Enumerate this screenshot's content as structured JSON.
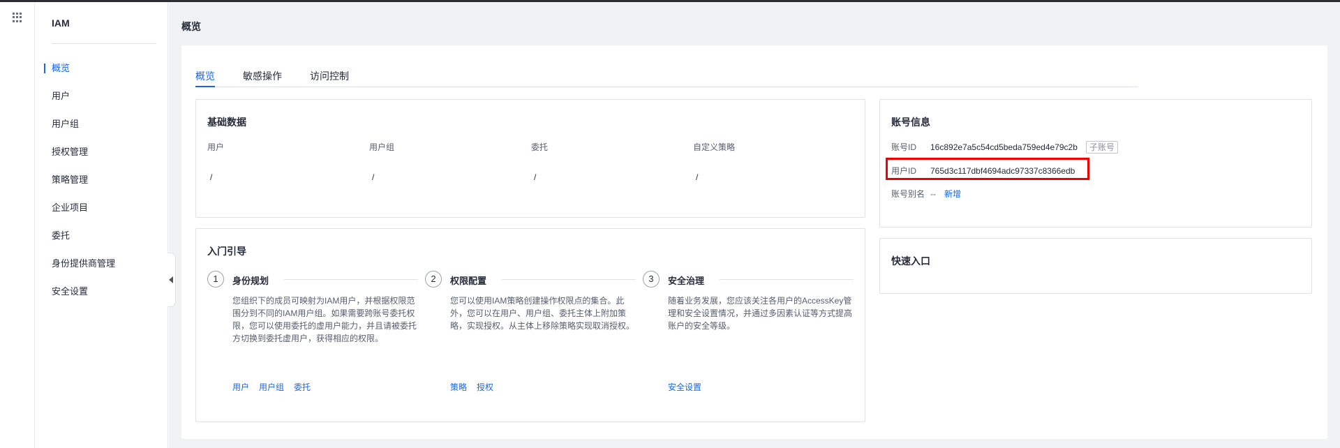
{
  "app": {
    "title": "IAM"
  },
  "sidebar": {
    "items": [
      {
        "label": "概览",
        "active": true
      },
      {
        "label": "用户"
      },
      {
        "label": "用户组"
      },
      {
        "label": "授权管理"
      },
      {
        "label": "策略管理"
      },
      {
        "label": "企业项目"
      },
      {
        "label": "委托"
      },
      {
        "label": "身份提供商管理"
      },
      {
        "label": "安全设置"
      }
    ]
  },
  "page": {
    "title": "概览"
  },
  "tabs": [
    {
      "label": "概览",
      "active": true
    },
    {
      "label": "敏感操作"
    },
    {
      "label": "访问控制"
    }
  ],
  "basic_data": {
    "title": "基础数据",
    "stats": [
      {
        "label": "用户",
        "value": "/"
      },
      {
        "label": "用户组",
        "value": "/"
      },
      {
        "label": "委托",
        "value": "/"
      },
      {
        "label": "自定义策略",
        "value": "/"
      }
    ]
  },
  "guide": {
    "title": "入门引导",
    "steps": [
      {
        "num": "1",
        "title": "身份规划",
        "desc": "您组织下的成员可映射为IAM用户，并根据权限范围分到不同的IAM用户组。如果需要跨账号委托权限，您可以使用委托的虚用户能力，并且请被委托方切换到委托虚用户，获得相应的权限。",
        "links": [
          "用户",
          "用户组",
          "委托"
        ]
      },
      {
        "num": "2",
        "title": "权限配置",
        "desc": "您可以使用IAM策略创建操作权限点的集合。此外，您可以在用户、用户组、委托主体上附加策略，实现授权。从主体上移除策略实现取消授权。",
        "links": [
          "策略",
          "授权"
        ]
      },
      {
        "num": "3",
        "title": "安全治理",
        "desc": "随着业务发展，您应该关注各用户的AccessKey管理和安全设置情况，并通过多因素认证等方式提高账户的安全等级。",
        "links": [
          "安全设置"
        ]
      }
    ]
  },
  "account": {
    "title": "账号信息",
    "account_id_label": "账号ID",
    "account_id": "16c892e7a5c54cd5beda759ed4e79c2b",
    "sub_badge": "子账号",
    "user_id_label": "用户ID",
    "user_id": "765d3c117dbf4694adc97337c8366edb",
    "alias_label": "账号别名",
    "alias_value": "--",
    "alias_add": "新增",
    "highlight_color": "#f00000"
  },
  "quick": {
    "title": "快速入口"
  },
  "colors": {
    "accent": "#1a64e6",
    "page_bg": "#f1f2f5"
  }
}
